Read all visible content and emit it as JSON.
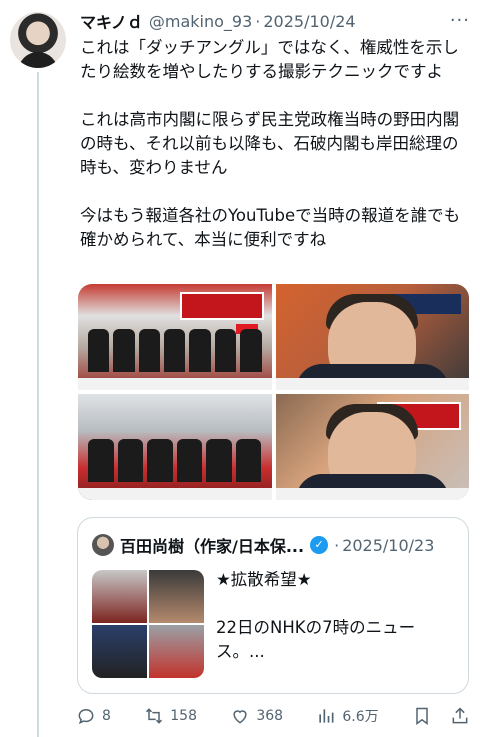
{
  "tweet": {
    "author_name": "マキノｄ",
    "handle": "@makino_93",
    "separator": "·",
    "date": "2025/10/24",
    "more_label": "···",
    "text": "これは「ダッチアングル」ではなく、権威性を示したり絵数を増やしたりする撮影テクニックですよ\n\nこれは高市内閣に限らず民主党政権当時の野田内閣の時も、それ以前も以降も、石破内閣も岸田総理の時も、変わりません\n\n今はもう報道各社のYouTubeで当時の報道を誰でも確かめられて、本当に便利ですね"
  },
  "quote": {
    "author_name": "百田尚樹（作家/日本保...",
    "separator": "·",
    "date": "2025/10/23",
    "text": "★拡散希望★\n\n22日のNHKの7時のニュース。..."
  },
  "actions": {
    "reply_count": "8",
    "retweet_count": "158",
    "like_count": "368",
    "views_count": "6.6万"
  },
  "icons": [
    "reply-icon",
    "retweet-icon",
    "like-icon",
    "views-icon",
    "bookmark-icon",
    "share-icon",
    "verified-badge-icon",
    "more-icon"
  ],
  "colors": {
    "text": "#0f1419",
    "muted": "#536471",
    "border": "#cfd9de",
    "verified": "#1d9bf0"
  }
}
